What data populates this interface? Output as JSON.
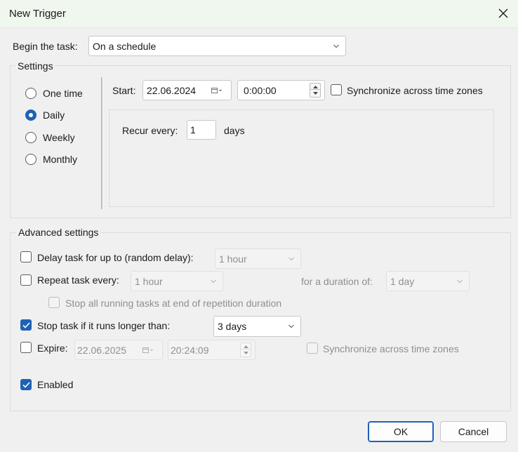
{
  "window": {
    "title": "New Trigger"
  },
  "begin_task": {
    "label": "Begin the task:",
    "value": "On a schedule"
  },
  "settings": {
    "group_label": "Settings",
    "options": [
      {
        "label": "One time",
        "checked": false
      },
      {
        "label": "Daily",
        "checked": true
      },
      {
        "label": "Weekly",
        "checked": false
      },
      {
        "label": "Monthly",
        "checked": false
      }
    ],
    "start_label": "Start:",
    "start_date": "22.06.2024",
    "start_time": "0:00:00",
    "sync_label": "Synchronize across time zones",
    "recur_label": "Recur every:",
    "recur_value": "1",
    "recur_unit": "days"
  },
  "advanced": {
    "group_label": "Advanced settings",
    "delay_label": "Delay task for up to (random delay):",
    "delay_value": "1 hour",
    "repeat_label": "Repeat task every:",
    "repeat_value": "1 hour",
    "duration_label": "for a duration of:",
    "duration_value": "1 day",
    "stop_all_label": "Stop all running tasks at end of repetition duration",
    "stop_longer_label": "Stop task if it runs longer than:",
    "stop_longer_value": "3 days",
    "expire_label": "Expire:",
    "expire_date": "22.06.2025",
    "expire_time": "20:24:09",
    "expire_sync_label": "Synchronize across time zones",
    "enabled_label": "Enabled"
  },
  "buttons": {
    "ok": "OK",
    "cancel": "Cancel"
  },
  "colors": {
    "accent": "#1e62b6",
    "titlebar": "#f0f7ee"
  }
}
